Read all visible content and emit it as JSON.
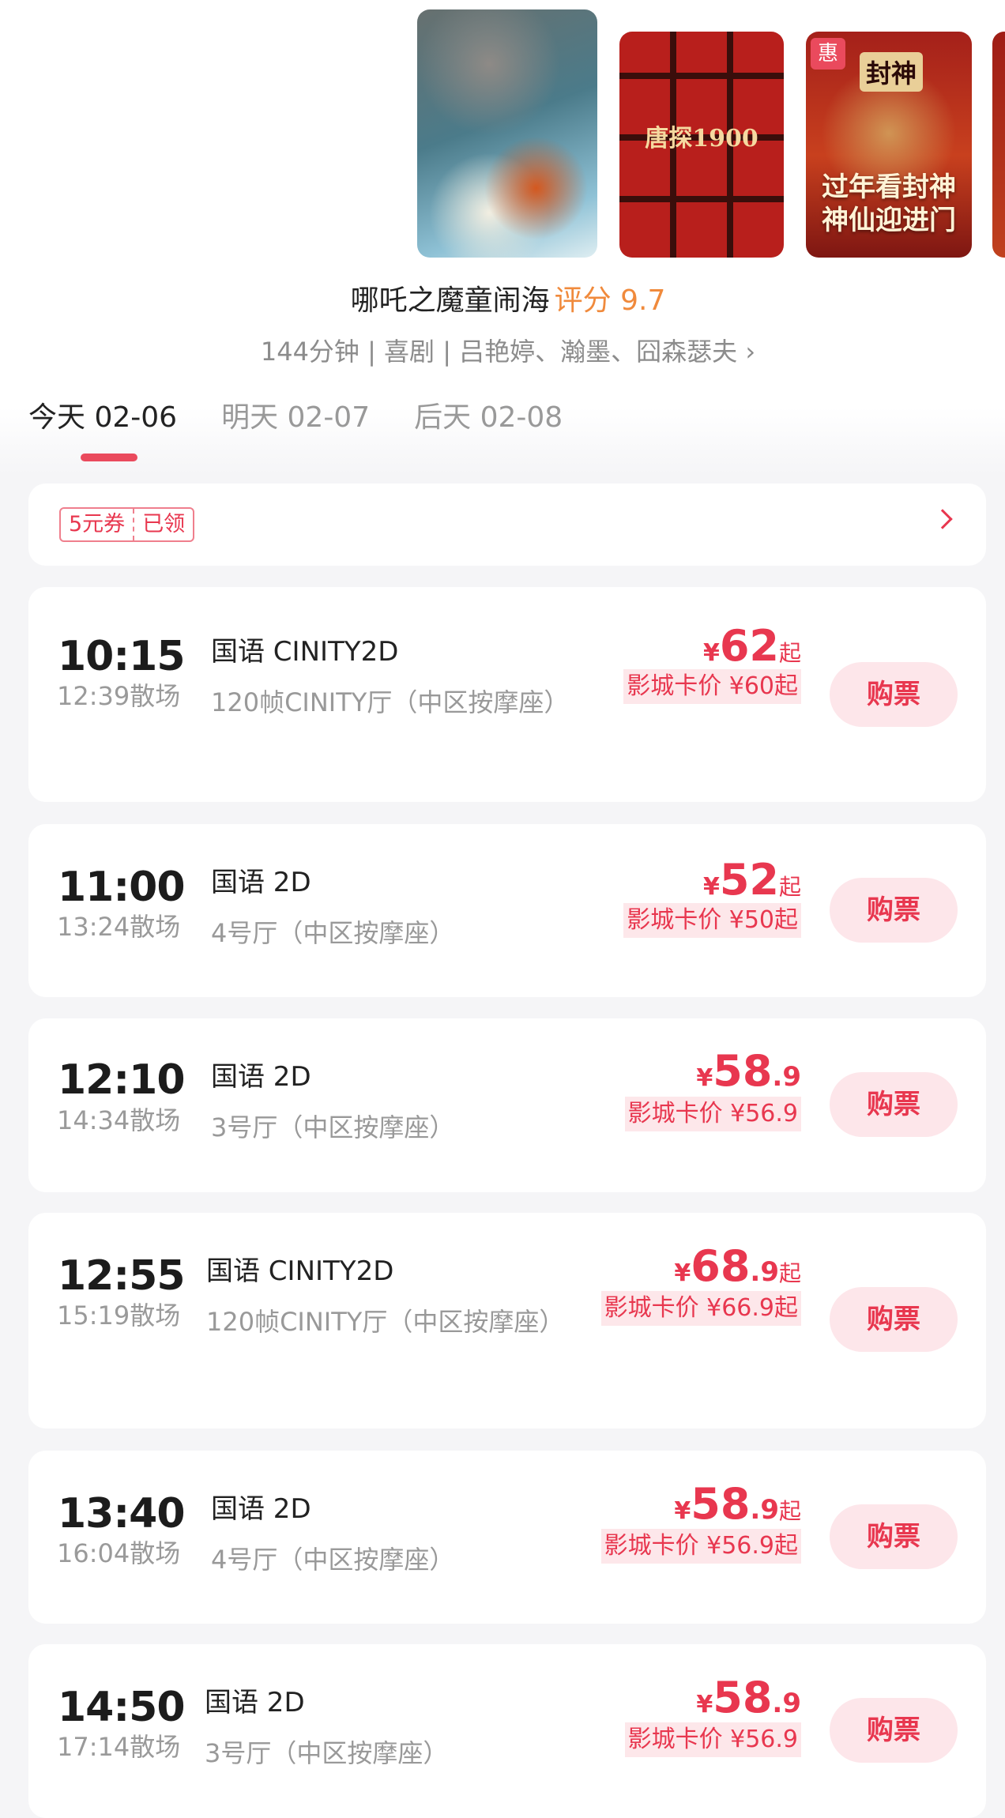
{
  "posters": [
    {
      "name": "nezha-poster",
      "text": ""
    },
    {
      "name": "tan-poster",
      "text": "唐探1900"
    },
    {
      "name": "fengshen-poster",
      "title": "封神",
      "text": "过年看封神\n神仙迎进门",
      "badge": "惠"
    },
    {
      "name": "partial-poster",
      "text": ""
    }
  ],
  "movie": {
    "title": "哪吒之魔童闹海",
    "rating_label": "评分 9.7",
    "meta": "144分钟 | 喜剧 | 吕艳婷、瀚墨、囧森瑟夫 ›"
  },
  "date_tabs": [
    {
      "label": "今天 02-06",
      "active": true
    },
    {
      "label": "明天 02-07",
      "active": false
    },
    {
      "label": "后天 02-08",
      "active": false
    }
  ],
  "coupon": {
    "amount": "5元券",
    "status": "已领"
  },
  "showtimes": [
    {
      "time": "10:15",
      "end": "12:39散场",
      "lang": "国语 CINITY2D",
      "hall": "120帧CINITY厅（中区按摩座）",
      "yen": "¥",
      "price_int": "62",
      "price_dec": "",
      "suffix": "起",
      "card": "影城卡价 ¥60起",
      "buy": "购票"
    },
    {
      "time": "11:00",
      "end": "13:24散场",
      "lang": "国语 2D",
      "hall": "4号厅（中区按摩座）",
      "yen": "¥",
      "price_int": "52",
      "price_dec": "",
      "suffix": "起",
      "card": "影城卡价 ¥50起",
      "buy": "购票"
    },
    {
      "time": "12:10",
      "end": "14:34散场",
      "lang": "国语 2D",
      "hall": "3号厅（中区按摩座）",
      "yen": "¥",
      "price_int": "58",
      "price_dec": ".9",
      "suffix": "",
      "card": "影城卡价 ¥56.9",
      "buy": "购票"
    },
    {
      "time": "12:55",
      "end": "15:19散场",
      "lang": "国语 CINITY2D",
      "hall": "120帧CINITY厅（中区按摩座）",
      "yen": "¥",
      "price_int": "68",
      "price_dec": ".9",
      "suffix": "起",
      "card": "影城卡价 ¥66.9起",
      "buy": "购票"
    },
    {
      "time": "13:40",
      "end": "16:04散场",
      "lang": "国语 2D",
      "hall": "4号厅（中区按摩座）",
      "yen": "¥",
      "price_int": "58",
      "price_dec": ".9",
      "suffix": "起",
      "card": "影城卡价 ¥56.9起",
      "buy": "购票"
    },
    {
      "time": "14:50",
      "end": "17:14散场",
      "lang": "国语 2D",
      "hall": "3号厅（中区按摩座）",
      "yen": "¥",
      "price_int": "58",
      "price_dec": ".9",
      "suffix": "",
      "card": "影城卡价 ¥56.9",
      "buy": "购票"
    }
  ]
}
